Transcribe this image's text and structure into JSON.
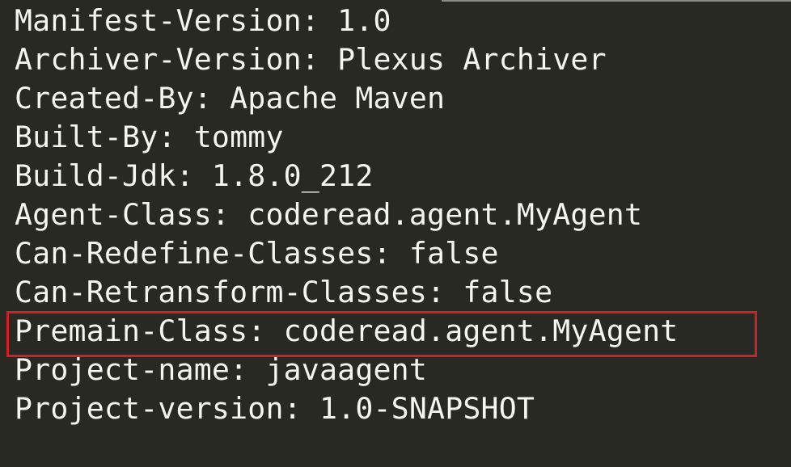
{
  "manifest": {
    "lines": [
      "Manifest-Version: 1.0",
      "Archiver-Version: Plexus Archiver",
      "Created-By: Apache Maven",
      "Built-By: tommy",
      "Build-Jdk: 1.8.0_212",
      "Agent-Class: coderead.agent.MyAgent",
      "Can-Redefine-Classes: false",
      "Can-Retransform-Classes: false",
      "Premain-Class: coderead.agent.MyAgent",
      "Project-name: javaagent",
      "Project-version: 1.0-SNAPSHOT"
    ]
  },
  "colors": {
    "background": "#282923",
    "text": "#f5f5f2",
    "highlight_border": "#d11f26"
  }
}
